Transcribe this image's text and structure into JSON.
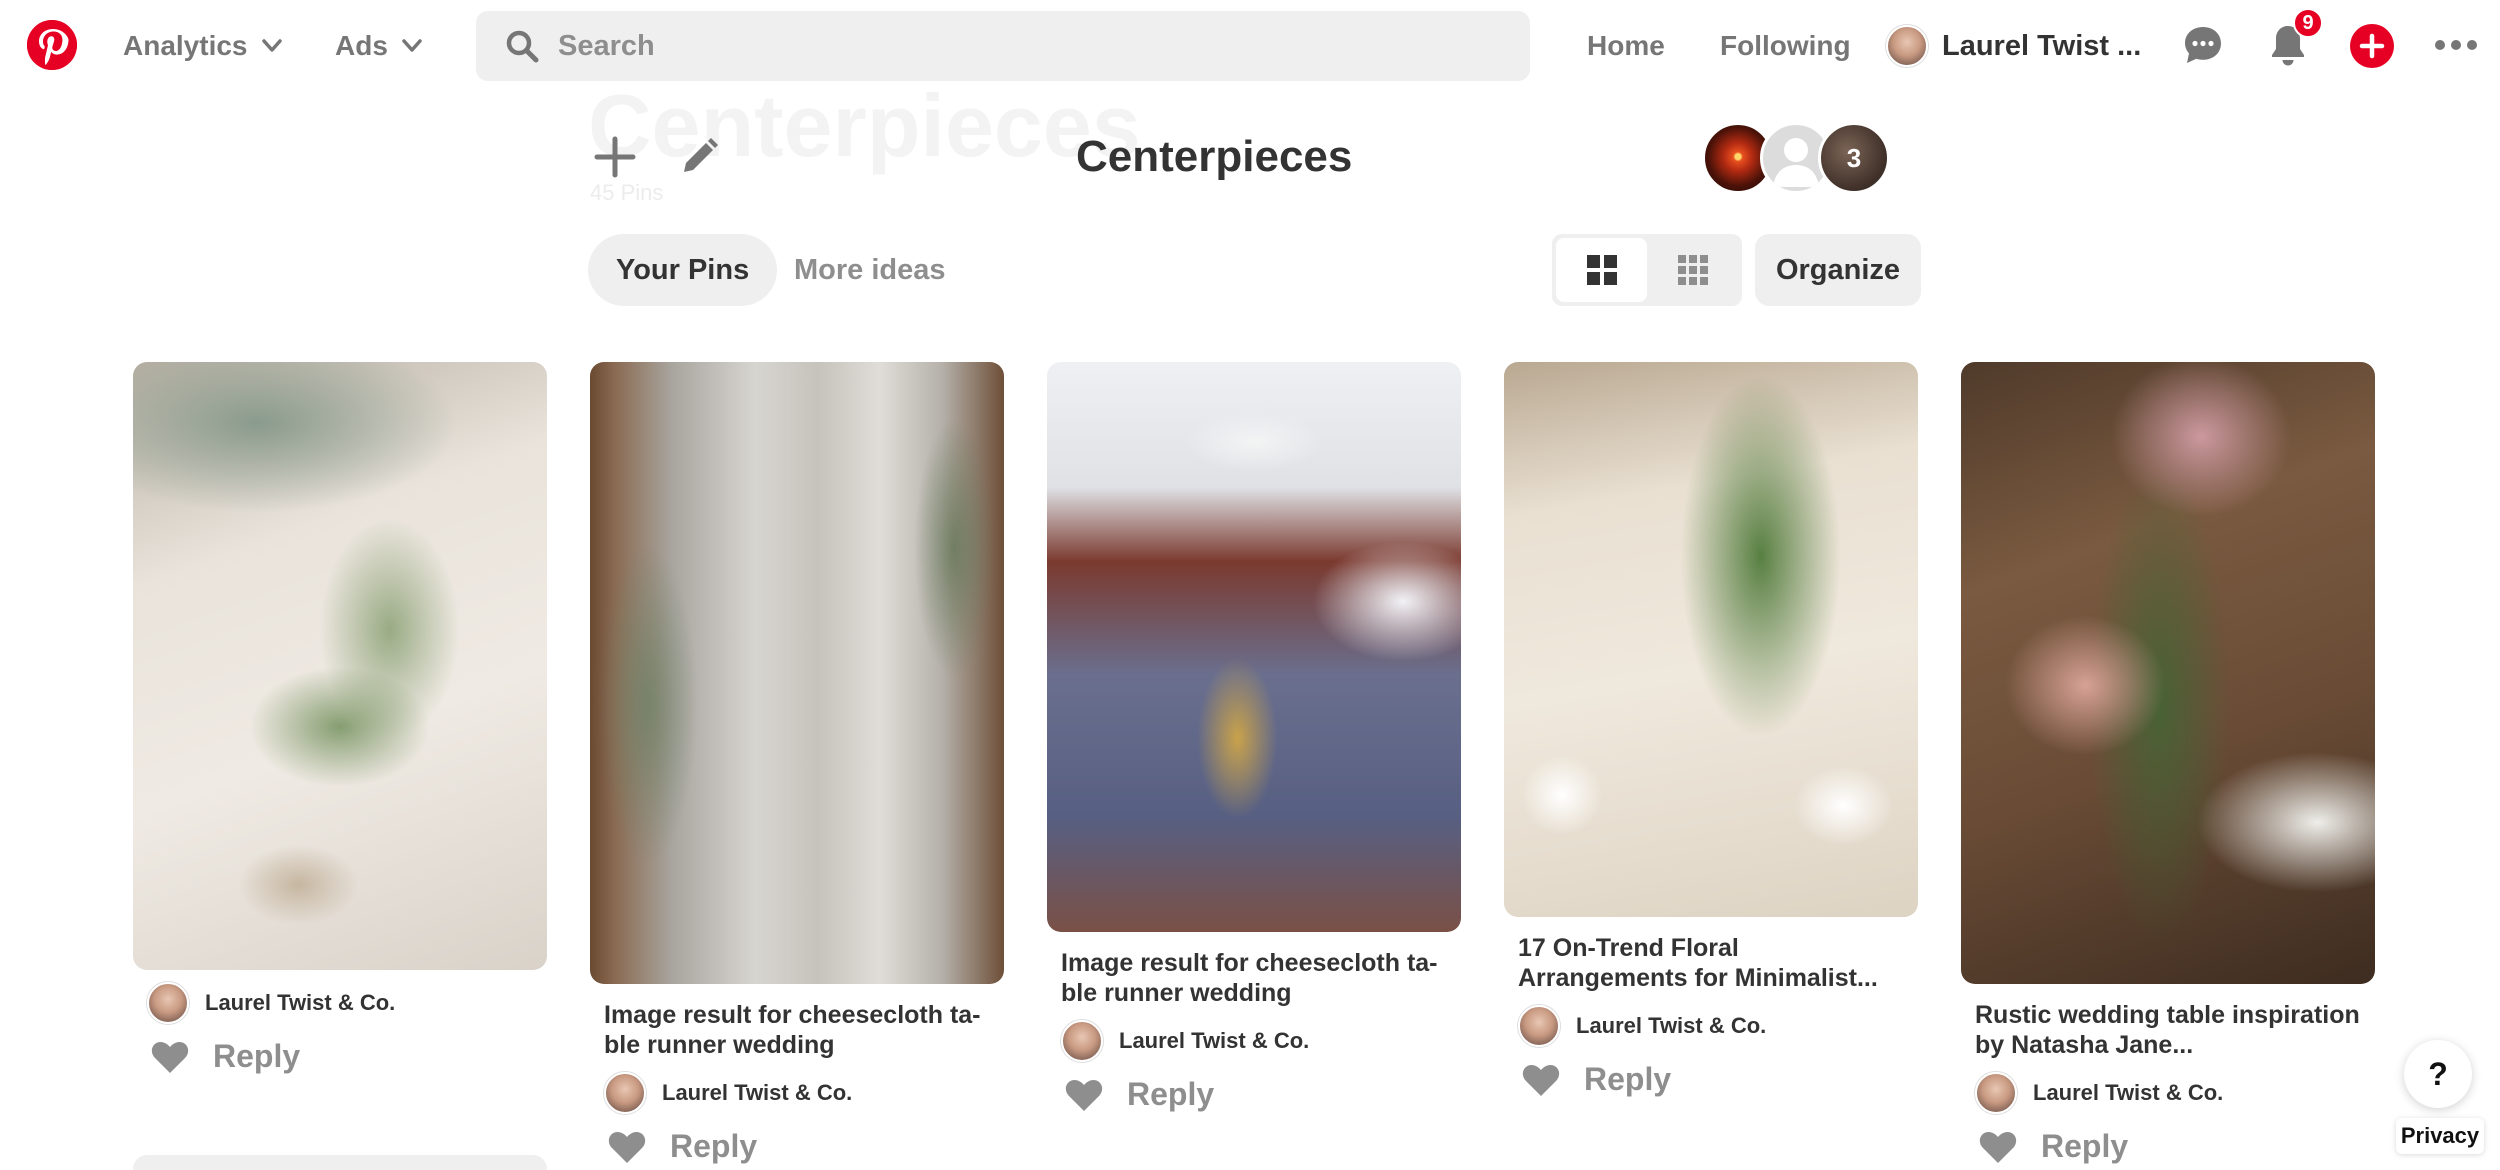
{
  "topbar": {
    "logo": "pinterest-logo",
    "nav": [
      {
        "label": "Analytics"
      },
      {
        "label": "Ads"
      }
    ],
    "search": {
      "placeholder": "Search",
      "value": ""
    },
    "links": [
      {
        "label": "Home"
      },
      {
        "label": "Following"
      }
    ],
    "user": {
      "name": "Laurel Twist ..."
    },
    "notifications_count": "9",
    "colors": {
      "brand": "#e60023",
      "muted": "#767676"
    }
  },
  "board": {
    "ghost_title": "Centerpieces",
    "ghost_subtitle": "45 Pins",
    "title": "Centerpieces",
    "collaborators_more": "3",
    "tabs": [
      {
        "label": "Your Pins",
        "active": true
      },
      {
        "label": "More ideas",
        "active": false
      }
    ],
    "organize_label": "Organize"
  },
  "pins": [
    {
      "title": "",
      "author": "Laurel Twist & Co.",
      "reply": "Reply"
    },
    {
      "title": "Image result for cheesecloth ta-ble runner wedding",
      "author": "Laurel Twist & Co.",
      "reply": "Reply"
    },
    {
      "title": "Image result for cheesecloth ta-ble runner wedding",
      "author": "Laurel Twist & Co.",
      "reply": "Reply"
    },
    {
      "title": "17 On-Trend Floral Arrangements for Minimalist...",
      "author": "Laurel Twist & Co.",
      "reply": "Reply"
    },
    {
      "title": "Rustic wedding table inspiration by Natasha Jane...",
      "author": "Laurel Twist & Co.",
      "reply": "Reply"
    }
  ],
  "help": {
    "label": "?"
  },
  "privacy": {
    "label": "Privacy"
  }
}
